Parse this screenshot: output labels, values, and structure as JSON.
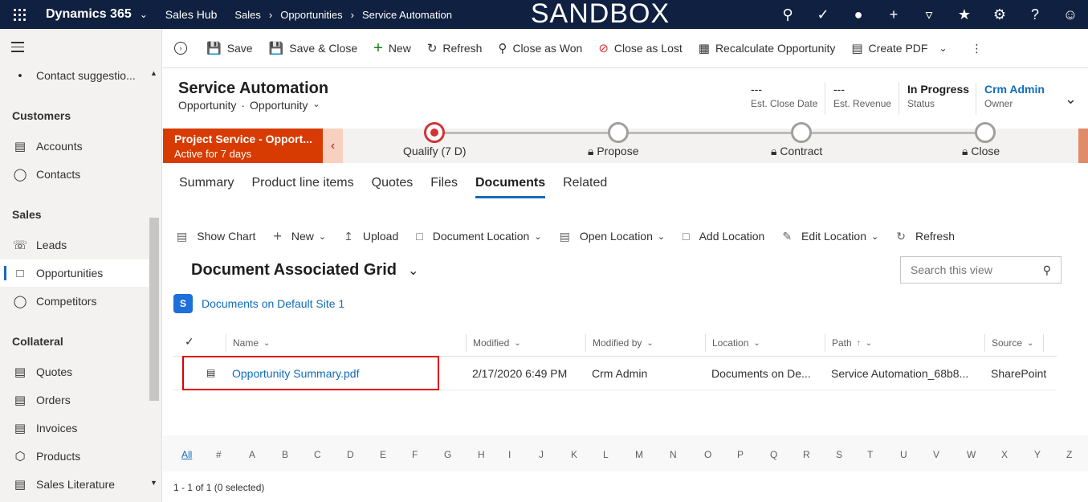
{
  "topbar": {
    "app_name": "Dynamics 365",
    "hub": "Sales Hub",
    "breadcrumbs": [
      "Sales",
      "Opportunities",
      "Service Automation"
    ],
    "watermark": "SANDBOX",
    "icons": [
      "search-icon",
      "task-icon",
      "lightbulb-icon",
      "plus-icon",
      "filter-icon",
      "assistant-icon",
      "gear-icon",
      "help-icon",
      "user-icon"
    ]
  },
  "leftnav": {
    "recent": "Contact suggestio...",
    "groups": [
      {
        "title": "Customers",
        "items": [
          {
            "label": "Accounts",
            "icon": "accounts-icon"
          },
          {
            "label": "Contacts",
            "icon": "contacts-icon"
          }
        ]
      },
      {
        "title": "Sales",
        "items": [
          {
            "label": "Leads",
            "icon": "leads-icon"
          },
          {
            "label": "Opportunities",
            "icon": "opportunities-icon"
          },
          {
            "label": "Competitors",
            "icon": "competitors-icon"
          }
        ]
      },
      {
        "title": "Collateral",
        "items": [
          {
            "label": "Quotes",
            "icon": "quotes-icon"
          },
          {
            "label": "Orders",
            "icon": "orders-icon"
          },
          {
            "label": "Invoices",
            "icon": "invoices-icon"
          },
          {
            "label": "Products",
            "icon": "products-icon"
          },
          {
            "label": "Sales Literature",
            "icon": "literature-icon"
          }
        ]
      }
    ]
  },
  "commands": {
    "save": "Save",
    "save_close": "Save & Close",
    "new": "New",
    "refresh": "Refresh",
    "close_won": "Close as Won",
    "close_lost": "Close as Lost",
    "recalculate": "Recalculate Opportunity",
    "create_pdf": "Create PDF"
  },
  "header": {
    "title": "Service Automation",
    "entity": "Opportunity",
    "form": "Opportunity",
    "close_date_value": "---",
    "close_date_label": "Est. Close Date",
    "revenue_value": "---",
    "revenue_label": "Est. Revenue",
    "status_value": "In Progress",
    "status_label": "Status",
    "owner_value": "Crm Admin",
    "owner_label": "Owner"
  },
  "process": {
    "name": "Project Service - Opport...",
    "duration": "Active for 7 days",
    "stages": [
      "Qualify  (7 D)",
      "Propose",
      "Contract",
      "Close"
    ]
  },
  "tabs": [
    "Summary",
    "Product line items",
    "Quotes",
    "Files",
    "Documents",
    "Related"
  ],
  "grid_toolbar": {
    "show_chart": "Show Chart",
    "new": "New",
    "upload": "Upload",
    "doc_location": "Document Location",
    "open_location": "Open Location",
    "add_location": "Add Location",
    "edit_location": "Edit Location",
    "refresh": "Refresh"
  },
  "view": {
    "title": "Document Associated Grid",
    "search_placeholder": "Search this view",
    "site_link": "Documents on Default Site 1"
  },
  "table": {
    "columns": [
      "Name",
      "Modified",
      "Modified by",
      "Location",
      "Path",
      "Source"
    ],
    "rows": [
      {
        "name": "Opportunity Summary.pdf",
        "modified": "2/17/2020 6:49 PM",
        "modified_by": "Crm  Admin",
        "location": "Documents on De...",
        "path": "Service Automation_68b8...",
        "source": "SharePoint"
      }
    ]
  },
  "alpha": [
    "All",
    "#",
    "A",
    "B",
    "C",
    "D",
    "E",
    "F",
    "G",
    "H",
    "I",
    "J",
    "K",
    "L",
    "M",
    "N",
    "O",
    "P",
    "Q",
    "R",
    "S",
    "T",
    "U",
    "V",
    "W",
    "X",
    "Y",
    "Z"
  ],
  "footer": "1 - 1 of 1 (0 selected)"
}
